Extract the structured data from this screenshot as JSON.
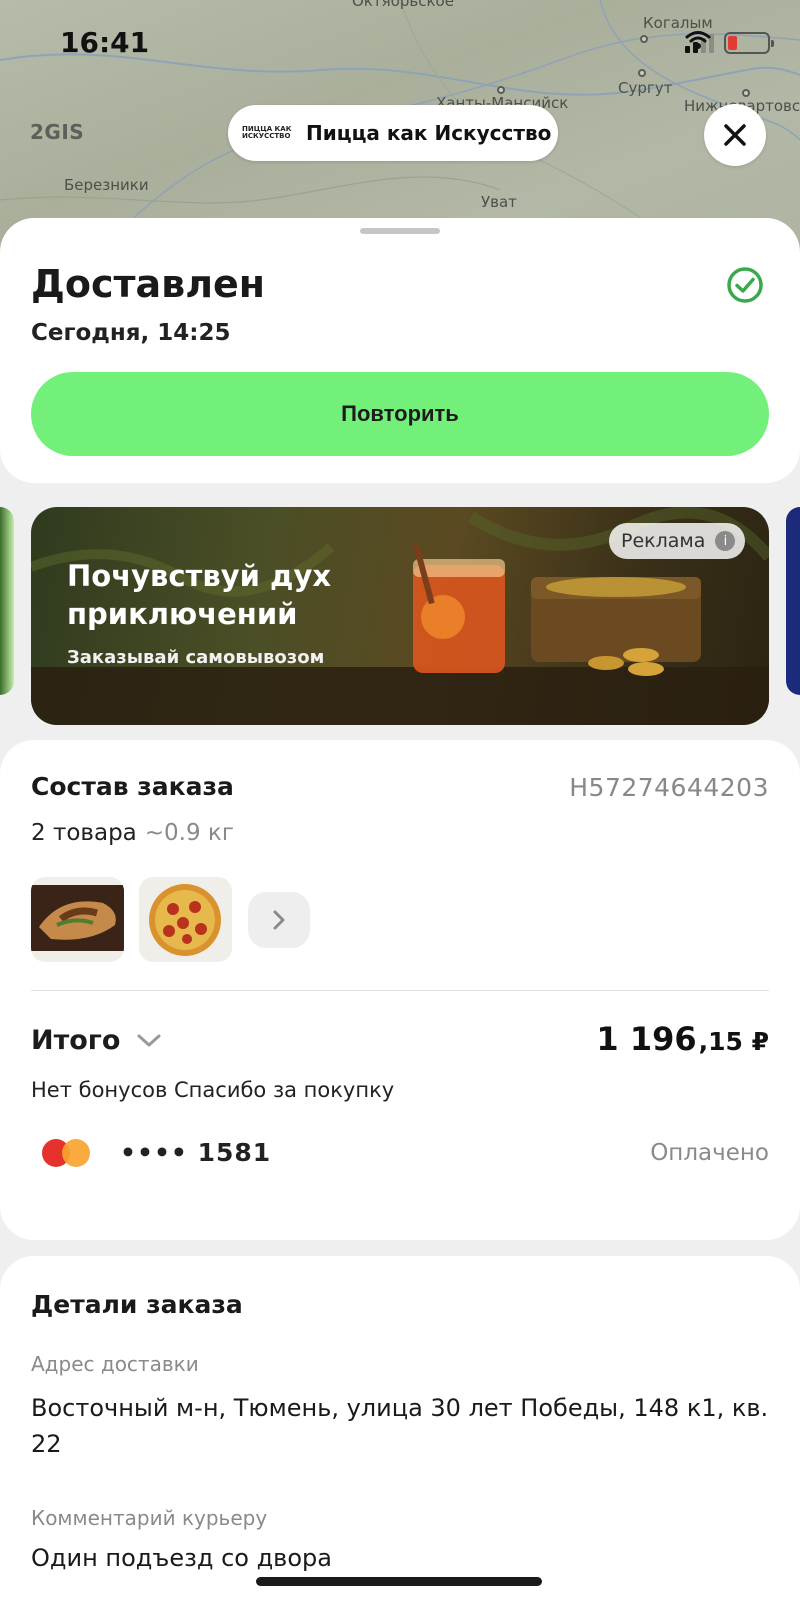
{
  "status_bar": {
    "time": "16:41"
  },
  "map": {
    "brand": "2GIS",
    "labels": [
      "Октябрьское",
      "Когалым",
      "Ханты-Мансийск",
      "Сургут",
      "Нижневартовск",
      "Березники",
      "Уват"
    ]
  },
  "header": {
    "store_logo_text": "ПИЦЦА КАК ИСКУССТВО",
    "store_name": "Пицца как Искусство",
    "close_icon": "close-icon"
  },
  "status": {
    "title": "Доставлен",
    "date": "Сегодня, 14:25",
    "icon": "check-circle-icon",
    "icon_color": "#3aa94a",
    "repeat_label": "Повторить",
    "repeat_color": "#72f07a"
  },
  "ad": {
    "headline": "Почувствуй дух приключений",
    "subtitle": "Заказывай самовывозом",
    "badge": "Реклама",
    "info_glyph": "i"
  },
  "order": {
    "title": "Состав заказа",
    "id": "Н57274644203",
    "count": "2 товара",
    "weight": "~0.9 кг",
    "items": [
      {
        "name": "shawarma",
        "icon": "shawarma-image"
      },
      {
        "name": "pepperoni-pizza",
        "icon": "pizza-image"
      }
    ],
    "more_icon": "chevron-right-icon",
    "total_label": "Итого",
    "total_whole": "1 196",
    "total_fraction": ",15 ₽",
    "bonus_text": "Нет бонусов Спасибо за покупку",
    "card_masked": "•••• 1581",
    "card_brand_icon": "mastercard-icon",
    "payment_status": "Оплачено"
  },
  "details": {
    "title": "Детали заказа",
    "address_label": "Адрес доставки",
    "address_value": "Восточный м-н, Тюмень, улица 30 лет Победы, 148 к1, кв. 22",
    "comment_label": "Комментарий курьеру",
    "comment_value": "Один подъезд со двора"
  }
}
